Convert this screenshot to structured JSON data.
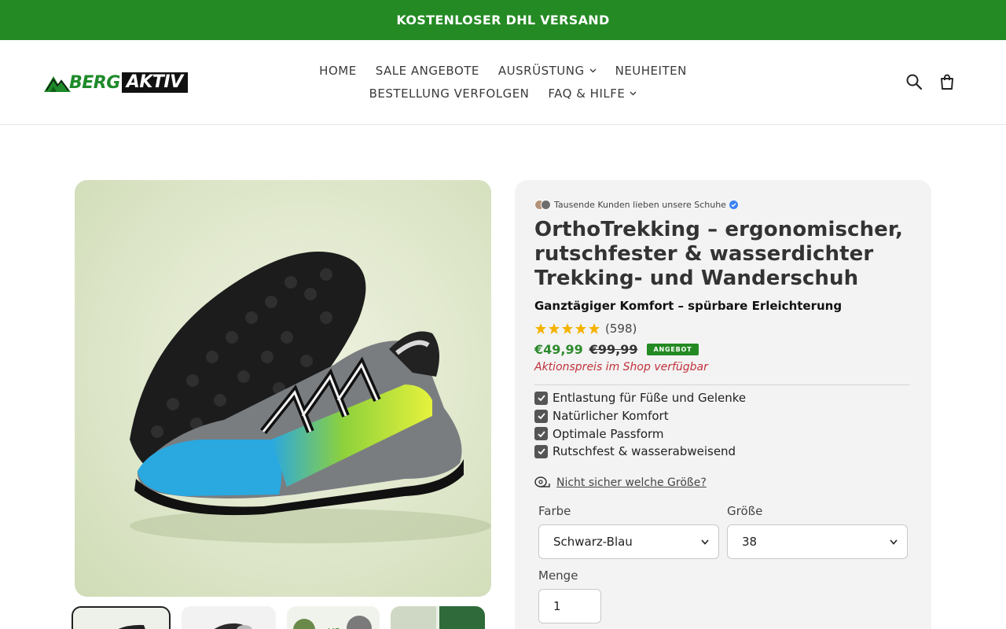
{
  "announcement": {
    "text": "KOSTENLOSER DHL VERSAND"
  },
  "brand": {
    "logo_part1": "BERG",
    "logo_part2": "AKTIV",
    "color_green": "#1e8a2a"
  },
  "nav": {
    "row1": [
      {
        "label": "HOME",
        "dropdown": false
      },
      {
        "label": "SALE ANGEBOTE",
        "dropdown": false
      },
      {
        "label": "AUSRÜSTUNG",
        "dropdown": true
      },
      {
        "label": "NEUHEITEN",
        "dropdown": false
      }
    ],
    "row2": [
      {
        "label": "BESTELLUNG VERFOLGEN",
        "dropdown": false
      },
      {
        "label": "FAQ & HILFE",
        "dropdown": true
      }
    ]
  },
  "header_icons": [
    "search-icon",
    "cart-icon"
  ],
  "product": {
    "social_proof": "Tausende Kunden lieben unsere Schuhe",
    "title": "OrthoTrekking – ergonomischer, rutschfester & wasserdichter Trekking- und Wanderschuh",
    "subtitle": "Ganztägiger Komfort – spürbare Erleichterung",
    "rating": {
      "stars": 5,
      "count": "(598)"
    },
    "price_now": "€49,99",
    "price_old": "€99,99",
    "badge": "ANGEBOT",
    "promo": "Aktionspreis im Shop verfügbar",
    "features": [
      "Entlastung für Füße und Gelenke",
      "Natürlicher Komfort",
      "Optimale Passform",
      "Rutschfest & wasserabweisend"
    ],
    "size_help": "Nicht sicher welche Größe?",
    "color_label": "Farbe",
    "color_value": "Schwarz-Blau",
    "size_label": "Größe",
    "size_value": "38",
    "qty_label": "Menge",
    "qty_value": "1"
  },
  "colors": {
    "accent_green": "#248a24",
    "promo_red": "#c0313a"
  }
}
